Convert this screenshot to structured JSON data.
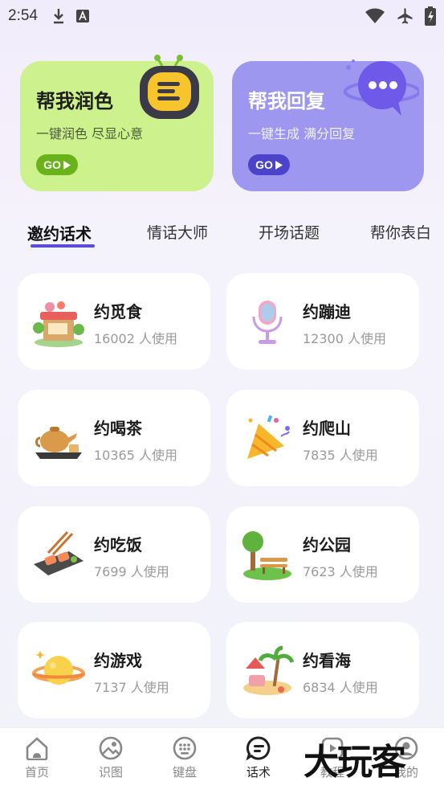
{
  "status_bar": {
    "time": "2:54",
    "icons": [
      "download-icon",
      "a-icon",
      "wifi-icon",
      "airplane-icon",
      "battery-icon"
    ]
  },
  "top_cards": [
    {
      "title": "帮我润色",
      "subtitle": "一键润色 尽显心意",
      "button": "GO",
      "color": "#cdf28d"
    },
    {
      "title": "帮我回复",
      "subtitle": "一键生成 满分回复",
      "button": "GO",
      "color": "#9d97f0"
    }
  ],
  "tabs": [
    {
      "label": "邀约话术",
      "active": true
    },
    {
      "label": "情话大师",
      "active": false
    },
    {
      "label": "开场话题",
      "active": false
    },
    {
      "label": "帮你表白",
      "active": false
    }
  ],
  "items": [
    {
      "title": "约觅食",
      "usage": "16002 人使用",
      "icon": "food-stall-icon"
    },
    {
      "title": "约蹦迪",
      "usage": "12300 人使用",
      "icon": "microphone-icon"
    },
    {
      "title": "约喝茶",
      "usage": "10365 人使用",
      "icon": "teapot-icon"
    },
    {
      "title": "约爬山",
      "usage": "7835 人使用",
      "icon": "party-popper-icon"
    },
    {
      "title": "约吃饭",
      "usage": "7699 人使用",
      "icon": "sushi-icon"
    },
    {
      "title": "约公园",
      "usage": "7623 人使用",
      "icon": "park-bench-icon"
    },
    {
      "title": "约游戏",
      "usage": "7137 人使用",
      "icon": "planet-icon"
    },
    {
      "title": "约看海",
      "usage": "6834 人使用",
      "icon": "beach-icon"
    }
  ],
  "bottom_nav": [
    {
      "label": "首页",
      "icon": "home-icon",
      "active": false
    },
    {
      "label": "识图",
      "icon": "image-recognize-icon",
      "active": false
    },
    {
      "label": "键盘",
      "icon": "keyboard-icon",
      "active": false
    },
    {
      "label": "话术",
      "icon": "chat-icon",
      "active": true
    },
    {
      "label": "教程",
      "icon": "tutorial-icon",
      "active": false
    },
    {
      "label": "我的",
      "icon": "profile-icon",
      "active": false
    }
  ],
  "watermark": "大玩客",
  "accent_color": "#5b4bd8"
}
